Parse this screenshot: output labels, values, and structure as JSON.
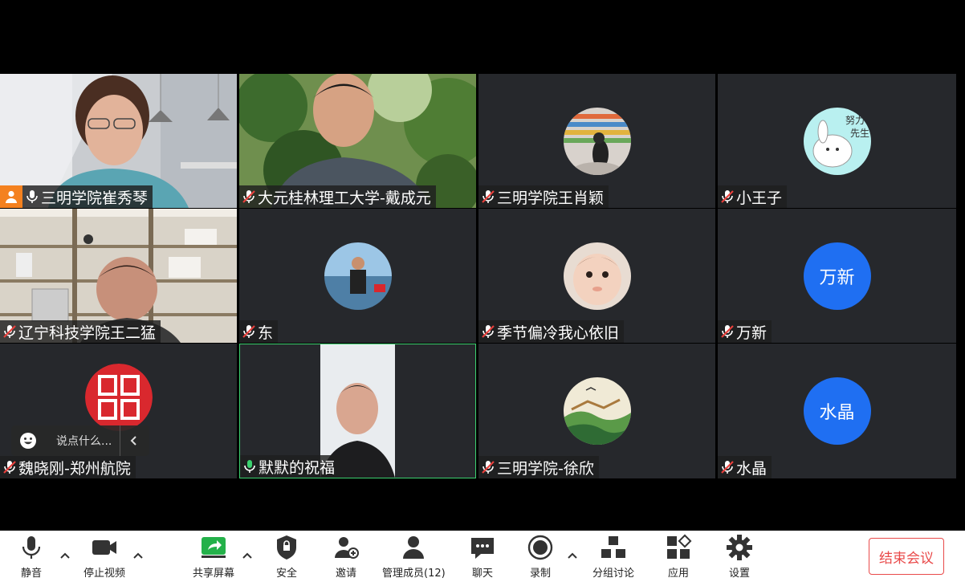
{
  "participants": [
    {
      "name": "三明学院崔秀琴",
      "host": true
    },
    {
      "name": "大元桂林理工大学-戴成元"
    },
    {
      "name": "三明学院王肖颖"
    },
    {
      "name": "小王子"
    },
    {
      "name": "辽宁科技学院王二猛"
    },
    {
      "name": "东"
    },
    {
      "name": "季节偏冷我心依旧"
    },
    {
      "name": "万新",
      "avatar_text": "万新"
    },
    {
      "name": "魏晓刚-郑州航院"
    },
    {
      "name": "默默的祝福",
      "speaking": true
    },
    {
      "name": "三明学院-徐欣"
    },
    {
      "name": "水晶",
      "avatar_text": "水晶"
    }
  ],
  "chat": {
    "placeholder": "说点什么..."
  },
  "toolbar": {
    "mute": "静音",
    "stop_video": "停止视频",
    "share_screen": "共享屏幕",
    "security": "安全",
    "invite": "邀请",
    "manage_members": "管理成员(12)",
    "chat": "聊天",
    "record": "录制",
    "breakout": "分组讨论",
    "apps": "应用",
    "settings": "设置",
    "end_meeting": "结束会议"
  },
  "colors": {
    "tile_bg": "#26282c",
    "avatar_blue": "#1f6ff2",
    "end_red": "#e94a4a",
    "speaking_green": "#3bd16f",
    "host_orange": "#f4811f"
  }
}
